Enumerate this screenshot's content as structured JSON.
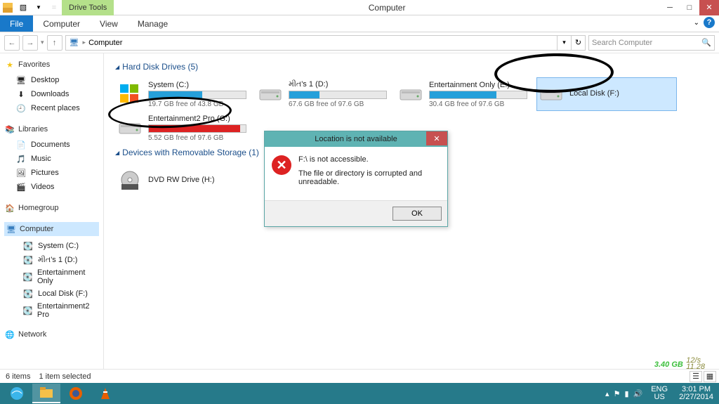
{
  "window": {
    "title": "Computer",
    "drive_tools_label": "Drive Tools"
  },
  "ribbon": {
    "file": "File",
    "tabs": [
      "Computer",
      "View",
      "Manage"
    ]
  },
  "breadcrumb": {
    "location": "Computer"
  },
  "search": {
    "placeholder": "Search Computer"
  },
  "sidebar": {
    "favorites": {
      "label": "Favorites",
      "items": [
        "Desktop",
        "Downloads",
        "Recent places"
      ]
    },
    "libraries": {
      "label": "Libraries",
      "items": [
        "Documents",
        "Music",
        "Pictures",
        "Videos"
      ]
    },
    "homegroup": {
      "label": "Homegroup"
    },
    "computer": {
      "label": "Computer",
      "items": [
        "System (C:)",
        "મીત's 1 (D:)",
        "Entertainment Only",
        "Local Disk (F:)",
        "Entertainment2 Pro"
      ]
    },
    "network": {
      "label": "Network"
    }
  },
  "sections": {
    "hdd": "Hard Disk Drives (5)",
    "removable": "Devices with Removable Storage (1)"
  },
  "drives": [
    {
      "name": "System (C:)",
      "free": "19.7 GB free of 43.8 GB",
      "fill": 55,
      "color": "blue",
      "win": true
    },
    {
      "name": "મીત's 1 (D:)",
      "free": "67.6 GB free of 97.6 GB",
      "fill": 31,
      "color": "blue"
    },
    {
      "name": "Entertainment Only (E:)",
      "free": "30.4 GB free of 97.6 GB",
      "fill": 69,
      "color": "blue"
    },
    {
      "name": "Local Disk (F:)",
      "free": "",
      "fill": 0,
      "color": "none",
      "selected": true
    },
    {
      "name": "Entertainment2 Pro (G:)",
      "free": "5.52 GB free of 97.6 GB",
      "fill": 94,
      "color": "red"
    }
  ],
  "removable": [
    {
      "name": "DVD RW Drive (H:)"
    }
  ],
  "dialog": {
    "title": "Location is not available",
    "line1": "F:\\ is not accessible.",
    "line2": "The file or directory is corrupted and unreadable.",
    "ok": "OK"
  },
  "statusbar": {
    "items": "6 items",
    "selected": "1 item selected"
  },
  "netmeter": {
    "value": "3.40 GB",
    "up": "12/s",
    "down": "11.28"
  },
  "tray": {
    "lang1": "ENG",
    "lang2": "US",
    "time": "3:01 PM",
    "date": "2/27/2014"
  }
}
